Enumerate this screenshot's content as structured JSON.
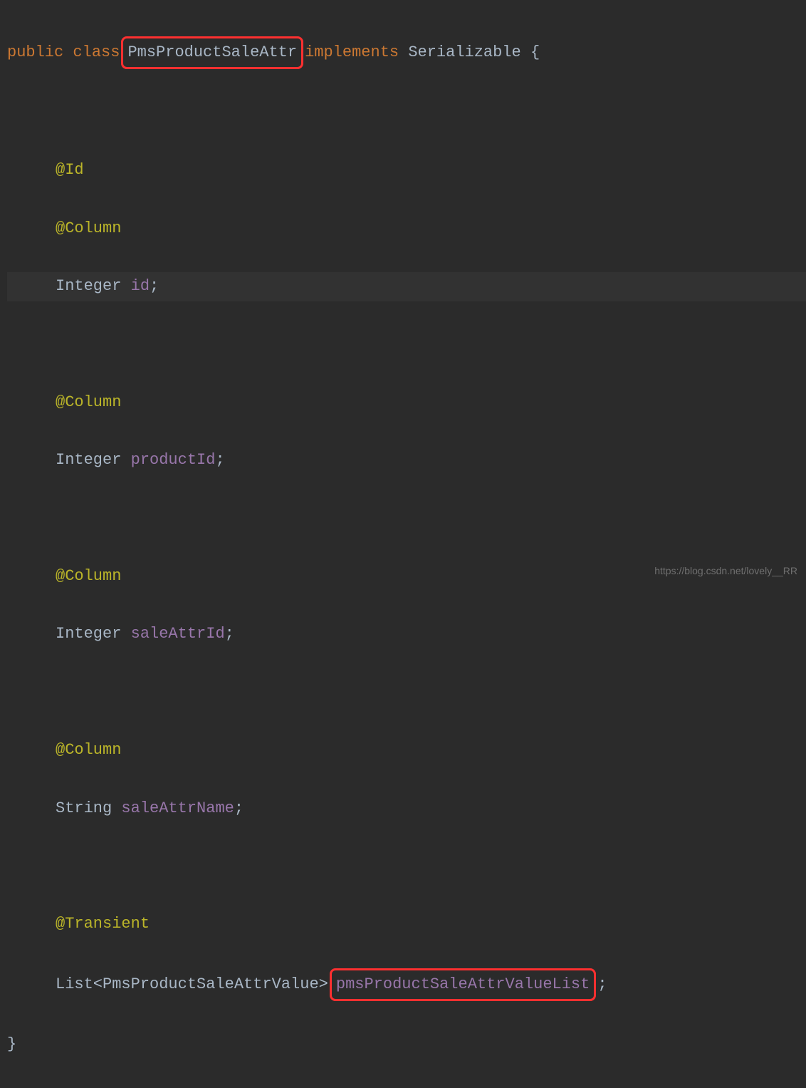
{
  "code": {
    "line1": {
      "kw_public": "public",
      "kw_class": "class",
      "className": "PmsProductSaleAttr",
      "kw_implements": "implements",
      "interface": "Serializable",
      "brace": "{"
    },
    "annotations": {
      "id": "@Id",
      "column": "@Column",
      "transient": "@Transient"
    },
    "fields": {
      "id": {
        "type": "Integer",
        "name": "id"
      },
      "productId": {
        "type": "Integer",
        "name": "productId"
      },
      "saleAttrId": {
        "type": "Integer",
        "name": "saleAttrId"
      },
      "saleAttrName": {
        "type": "String",
        "name": "saleAttrName"
      },
      "valueList": {
        "type": "List<PmsProductSaleAttrValue>",
        "name": "pmsProductSaleAttrValueList"
      }
    },
    "semicolon": ";",
    "closeBrace": "}"
  },
  "watermark": "https://blog.csdn.net/lovely__RR"
}
